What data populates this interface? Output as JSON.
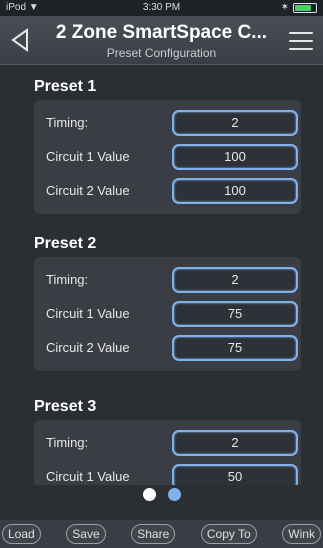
{
  "status_bar": {
    "device": "iPod",
    "time": "3:30 PM"
  },
  "header": {
    "title": "2 Zone SmartSpace C...",
    "subtitle": "Preset Configuration"
  },
  "presets": [
    {
      "title": "Preset 1",
      "timing_label": "Timing:",
      "timing": "2",
      "c1_label": "Circuit 1 Value",
      "c1": "100",
      "c2_label": "Circuit 2 Value",
      "c2": "100"
    },
    {
      "title": "Preset 2",
      "timing_label": "Timing:",
      "timing": "2",
      "c1_label": "Circuit 1 Value",
      "c1": "75",
      "c2_label": "Circuit 2 Value",
      "c2": "75"
    },
    {
      "title": "Preset 3",
      "timing_label": "Timing:",
      "timing": "2",
      "c1_label": "Circuit 1 Value",
      "c1": "50"
    }
  ],
  "toolbar": {
    "load": "Load",
    "save": "Save",
    "share": "Share",
    "copy_to": "Copy To",
    "wink": "Wink"
  },
  "colors": {
    "accent": "#7fb2ea",
    "background": "#2b2e33",
    "panel": "#3a3d43"
  }
}
